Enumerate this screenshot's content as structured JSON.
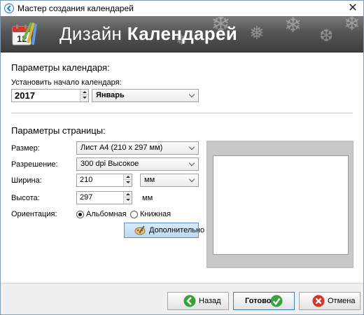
{
  "window": {
    "title": "Мастер создания календарей",
    "close_glyph": "✕"
  },
  "banner": {
    "title_regular": "Дизайн",
    "title_bold": "Календарей",
    "icon_day": "12",
    "icon": "calendar-with-brushes-icon"
  },
  "calendar_params": {
    "section_title": "Параметры календаря:",
    "start_label": "Установить начало календаря:",
    "year": "2017",
    "month": "Январь"
  },
  "page_params": {
    "section_title": "Параметры страницы:",
    "size_label": "Размер:",
    "size_value": "Лист А4 (210 х 297 мм)",
    "resolution_label": "Разрешение:",
    "resolution_value": "300 dpi Высокое",
    "width_label": "Ширина:",
    "width_value": "210",
    "width_unit": "мм",
    "height_label": "Высота:",
    "height_value": "297",
    "height_unit": "мм",
    "orientation_label": "Ориентация:",
    "orientation_options": [
      "Альбомная",
      "Книжная"
    ],
    "orientation_selected": "Альбомная",
    "advanced_button": "Дополнительно"
  },
  "footer": {
    "back_label": "Назад",
    "done_label": "Готово",
    "cancel_label": "Отмена"
  },
  "colors": {
    "banner_dark": "#3e3e3e",
    "accent_blue": "#bcd9f5",
    "ok_green": "#3ba13b",
    "cancel_red": "#d9342b",
    "back_green": "#3ba13b"
  }
}
